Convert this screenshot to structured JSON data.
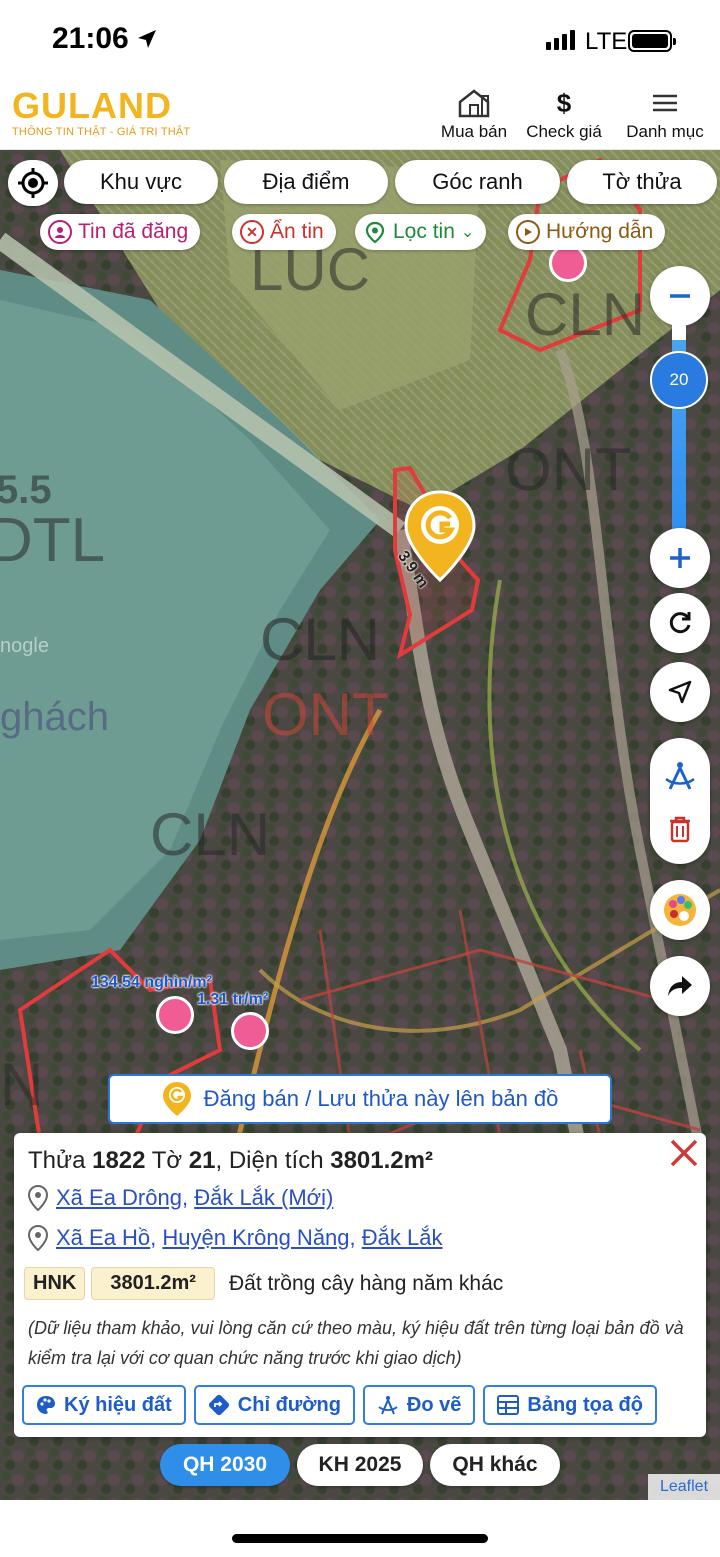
{
  "status_bar": {
    "time": "21:06",
    "network": "LTE"
  },
  "header": {
    "logo_text": "GULAND",
    "logo_tagline": "THÔNG TIN THẬT - GIÁ TRỊ THẬT",
    "nav": [
      {
        "label": "Mua bán",
        "icon": "house-icon"
      },
      {
        "label": "Check giá",
        "icon": "dollar-icon"
      },
      {
        "label": "Danh mục",
        "icon": "menu-icon"
      }
    ]
  },
  "filters": {
    "primary": [
      "Khu vực",
      "Địa điểm",
      "Góc ranh",
      "Tờ thửa"
    ],
    "posted": "Tin đã đăng",
    "hide": "Ẩn tin",
    "filter": "Lọc tin",
    "guide": "Hướng dẫn"
  },
  "map": {
    "zoom_level": "20",
    "zone_labels": [
      "LUC",
      "CLN",
      "ONT",
      "DTL",
      "CLN",
      "ONT",
      "CLN",
      "N"
    ],
    "misc_labels": [
      "5.5",
      "nogle",
      "ghách"
    ],
    "dimension_label": "3.9 m",
    "price_labels": [
      "134.54 nghìn/m²",
      "1.31 tr/m²"
    ],
    "colors": {
      "parcel_outline": "#e23b3b",
      "marker": "#f2b51f",
      "dot": "#ef5d94"
    }
  },
  "post_button": "Đăng bán / Lưu thửa này lên bản đồ",
  "panel": {
    "title_prefix": "Thửa",
    "parcel_no": "1822",
    "sheet_word": "Tờ",
    "sheet_no": "21",
    "area_word": ", Diện tích",
    "area": "3801.2m²",
    "address_new": {
      "commune": "Xã Ea Drông",
      "province": "Đắk Lắk (Mới)"
    },
    "address_old": {
      "commune": "Xã Ea Hồ",
      "district": "Huyện Krông Năng",
      "province": "Đắk Lắk"
    },
    "land_code": "HNK",
    "land_area": "3801.2m²",
    "land_type": "Đất trồng cây hàng năm khác",
    "note": "(Dữ liệu tham khảo, vui lòng căn cứ theo màu, ký hiệu đất trên từng loại bản đồ và kiểm tra lại với cơ quan chức năng trước khi giao dịch)",
    "actions": [
      "Ký hiệu đất",
      "Chỉ đường",
      "Đo vẽ",
      "Bảng tọa độ"
    ]
  },
  "layers": [
    "QH 2030",
    "KH 2025",
    "QH khác"
  ],
  "attribution": "Leaflet"
}
